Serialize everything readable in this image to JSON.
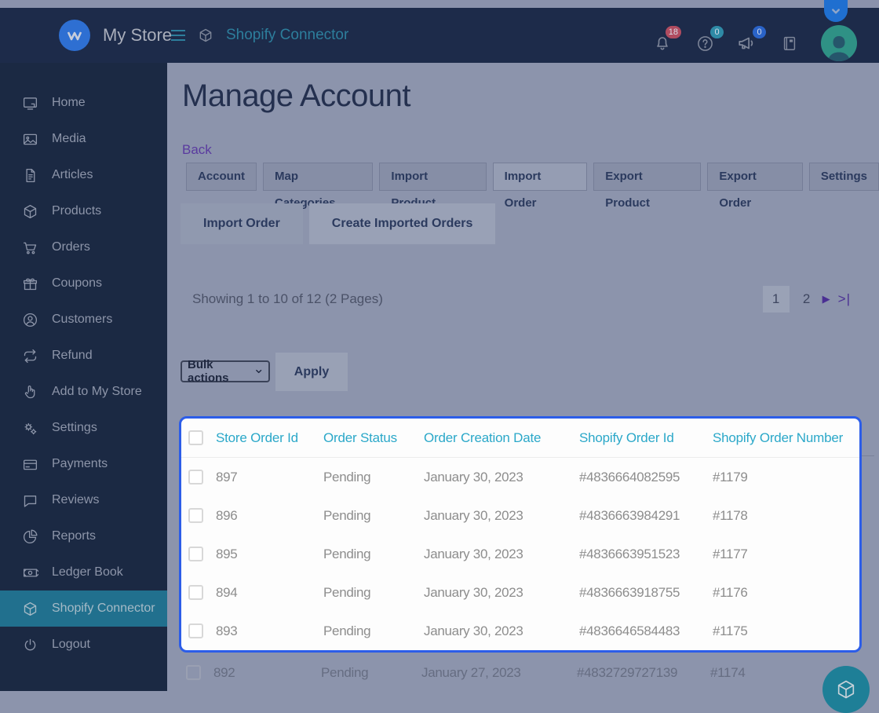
{
  "topbar": {
    "store_name": "My Store",
    "app_title": "Shopify Connector",
    "badges": {
      "notifications": "18",
      "help": "0",
      "announcements": "0"
    }
  },
  "sidebar": {
    "items": [
      {
        "label": "Home",
        "icon": "monitor-icon"
      },
      {
        "label": "Media",
        "icon": "image-icon"
      },
      {
        "label": "Articles",
        "icon": "file-icon"
      },
      {
        "label": "Products",
        "icon": "cube-icon"
      },
      {
        "label": "Orders",
        "icon": "cart-icon"
      },
      {
        "label": "Coupons",
        "icon": "gift-icon"
      },
      {
        "label": "Customers",
        "icon": "user-icon"
      },
      {
        "label": "Refund",
        "icon": "repeat-icon"
      },
      {
        "label": "Add to My Store",
        "icon": "hand-pointer-icon"
      },
      {
        "label": "Settings",
        "icon": "gears-icon"
      },
      {
        "label": "Payments",
        "icon": "credit-card-icon"
      },
      {
        "label": "Reviews",
        "icon": "chat-icon"
      },
      {
        "label": "Reports",
        "icon": "pie-chart-icon"
      },
      {
        "label": "Ledger Book",
        "icon": "banknote-icon"
      },
      {
        "label": "Shopify Connector",
        "icon": "cube-icon"
      },
      {
        "label": "Logout",
        "icon": "power-icon"
      }
    ],
    "active_item": "Shopify Connector"
  },
  "main": {
    "title": "Manage Account",
    "back_label": "Back",
    "tabs": [
      {
        "label": "Account"
      },
      {
        "label": "Map Categories"
      },
      {
        "label": "Import Product"
      },
      {
        "label": "Import Order"
      },
      {
        "label": "Export Product"
      },
      {
        "label": "Export Order"
      },
      {
        "label": "Settings"
      }
    ],
    "active_tab": "Import Order",
    "subtabs": [
      {
        "label": "Import Order"
      },
      {
        "label": "Create Imported Orders"
      }
    ],
    "pagination": {
      "summary": "Showing 1 to 10 of 12 (2 Pages)",
      "page_1": "1",
      "page_2": "2",
      "next_label": "▶",
      "last_label": ">|",
      "current_page": "1"
    },
    "bulk": {
      "select_value": "Bulk actions",
      "apply_label": "Apply"
    },
    "table": {
      "columns": [
        "Store Order Id",
        "Order Status",
        "Order Creation Date",
        "Shopify Order Id",
        "Shopify Order Number"
      ],
      "rows": [
        [
          "897",
          "Pending",
          "January 30, 2023",
          "#4836664082595",
          "#1179"
        ],
        [
          "896",
          "Pending",
          "January 30, 2023",
          "#4836663984291",
          "#1178"
        ],
        [
          "895",
          "Pending",
          "January 30, 2023",
          "#4836663951523",
          "#1177"
        ],
        [
          "894",
          "Pending",
          "January 30, 2023",
          "#4836663918755",
          "#1176"
        ],
        [
          "893",
          "Pending",
          "January 30, 2023",
          "#4836646584483",
          "#1175"
        ],
        [
          "892",
          "Pending",
          "January 27, 2023",
          "#4832729727139",
          "#1174"
        ]
      ]
    }
  },
  "colors": {
    "topbar_bg": "#1d2b4a",
    "sidebar_bg": "#1b2943",
    "sidebar_active_bg": "#21708e",
    "dim_overlay_bg": "#8c94ac",
    "highlight_border": "#2c5de8",
    "table_header_text": "#2ba8c9",
    "accent_purple": "#5a3b9f",
    "logo_blue": "#2e6fd2",
    "fab_teal": "#1e7f97",
    "badge_red": "#b04c60"
  }
}
